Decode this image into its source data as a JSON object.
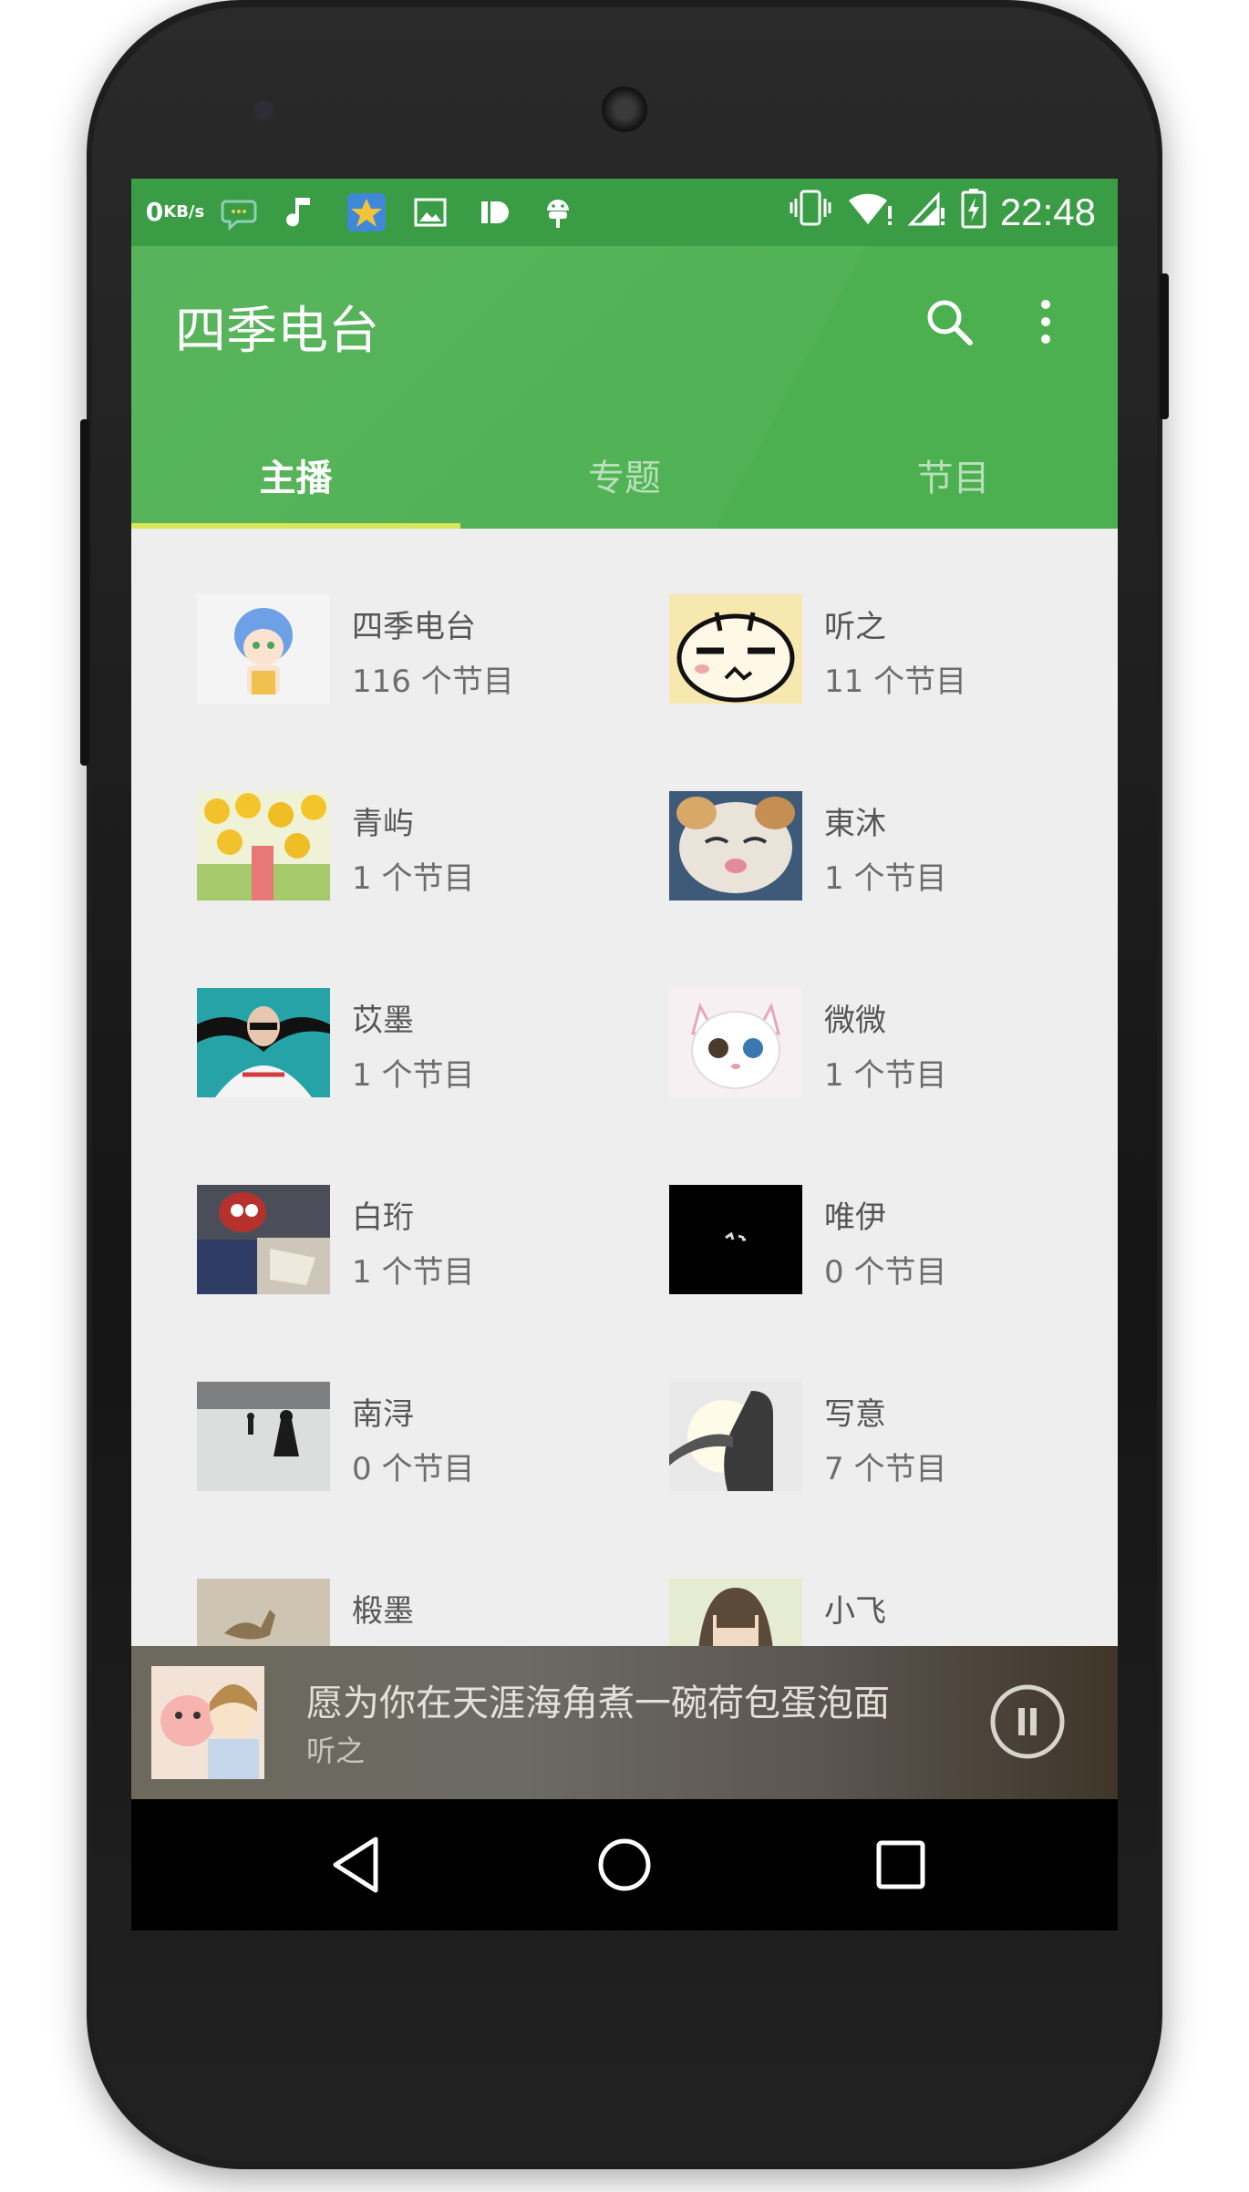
{
  "status_bar": {
    "net_speed_value": "0",
    "net_speed_unit": "KB/s",
    "time": "22:48",
    "left_icons": [
      "chat-bubble-icon",
      "music-note-icon",
      "star-app-icon",
      "image-icon",
      "id-app-icon",
      "android-icon"
    ],
    "right_icons": [
      "vibrate-icon",
      "wifi-icon",
      "signal-icon",
      "battery-charging-icon"
    ]
  },
  "appbar": {
    "title": "四季电台",
    "search_icon": "search-icon",
    "more_icon": "more-vert-icon"
  },
  "tabs": [
    {
      "label": "主播",
      "active": true
    },
    {
      "label": "专题",
      "active": false
    },
    {
      "label": "节目",
      "active": false
    }
  ],
  "hosts": [
    {
      "name": "四季电台",
      "count": "116 个节目"
    },
    {
      "name": "听之",
      "count": "11 个节目"
    },
    {
      "name": "青屿",
      "count": "1 个节目"
    },
    {
      "name": "東沐",
      "count": "1 个节目"
    },
    {
      "name": "苡墨",
      "count": "1 个节目"
    },
    {
      "name": "微微",
      "count": "1 个节目"
    },
    {
      "name": "白珩",
      "count": "1 个节目"
    },
    {
      "name": "唯伊",
      "count": "0 个节目"
    },
    {
      "name": "南浔",
      "count": "0 个节目"
    },
    {
      "name": "写意",
      "count": "7 个节目"
    },
    {
      "name": "椴墨",
      "count": ""
    },
    {
      "name": "小飞",
      "count": ""
    }
  ],
  "player": {
    "song": "愿为你在天涯海角煮一碗荷包蛋泡面",
    "artist": "听之",
    "state_icon": "pause-icon"
  },
  "navbar": {
    "back_icon": "back-icon",
    "home_icon": "home-icon",
    "recents_icon": "recents-icon"
  },
  "colors": {
    "primary": "#4caf50",
    "status_bar": "#3a9c45",
    "tab_indicator": "#d9e65a",
    "background": "#eeeeee"
  }
}
